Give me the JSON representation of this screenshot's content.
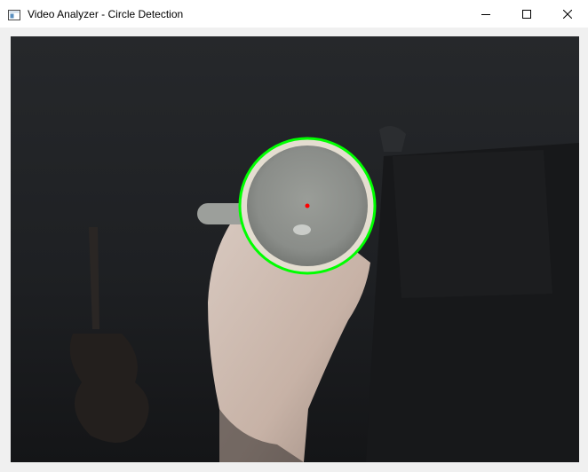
{
  "window": {
    "title": "Video Analyzer - Circle Detection",
    "icon": "app-window-icon"
  },
  "caption_buttons": [
    {
      "name": "minimize-button",
      "icon": "minimize-icon"
    },
    {
      "name": "maximize-button",
      "icon": "maximize-icon"
    },
    {
      "name": "close-button",
      "icon": "close-icon"
    }
  ],
  "video_frame": {
    "description_icon": "webcam-frame",
    "detected_circle_color": "#00ff00",
    "center_marker_color": "#ff0000"
  }
}
